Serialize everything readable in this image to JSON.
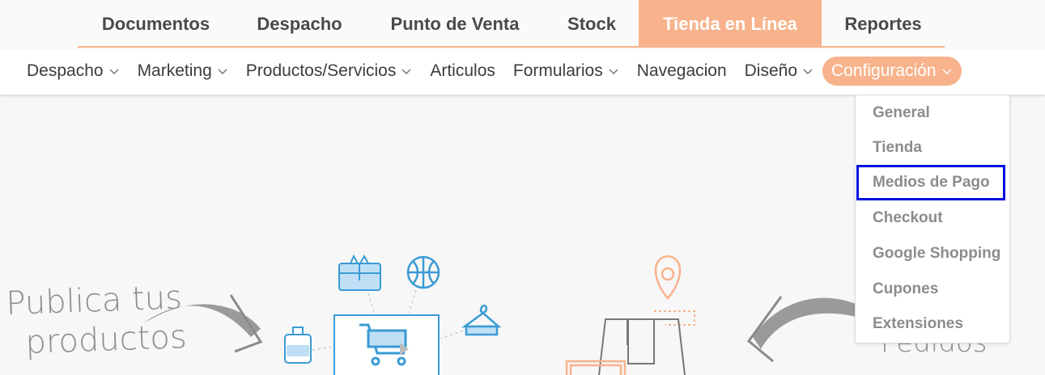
{
  "top_tabs": [
    {
      "label": "Documentos"
    },
    {
      "label": "Despacho"
    },
    {
      "label": "Punto de Venta"
    },
    {
      "label": "Stock"
    },
    {
      "label": "Tienda en Línea"
    },
    {
      "label": "Reportes"
    }
  ],
  "active_top_tab": "Tienda en Línea",
  "sub_nav": [
    {
      "label": "Despacho",
      "has_dropdown": true
    },
    {
      "label": "Marketing",
      "has_dropdown": true
    },
    {
      "label": "Productos/Servicios",
      "has_dropdown": true
    },
    {
      "label": "Articulos",
      "has_dropdown": false
    },
    {
      "label": "Formularios",
      "has_dropdown": true
    },
    {
      "label": "Navegacion",
      "has_dropdown": false
    },
    {
      "label": "Diseño",
      "has_dropdown": true
    },
    {
      "label": "Configuración",
      "has_dropdown": true
    }
  ],
  "active_sub_item": "Configuración",
  "dropdown": {
    "items": [
      "General",
      "Tienda",
      "Medios de Pago",
      "Checkout",
      "Google Shopping",
      "Cupones",
      "Extensiones"
    ],
    "highlighted": "Medios de Pago"
  },
  "hero": {
    "left_text_line1": "Publica tus",
    "left_text_line2": "productos",
    "right_text_partial": "Pedidos"
  },
  "colors": {
    "accent": "#f8b38c",
    "icon_blue": "#3a9bd5",
    "highlight_outline": "#0010e0"
  }
}
